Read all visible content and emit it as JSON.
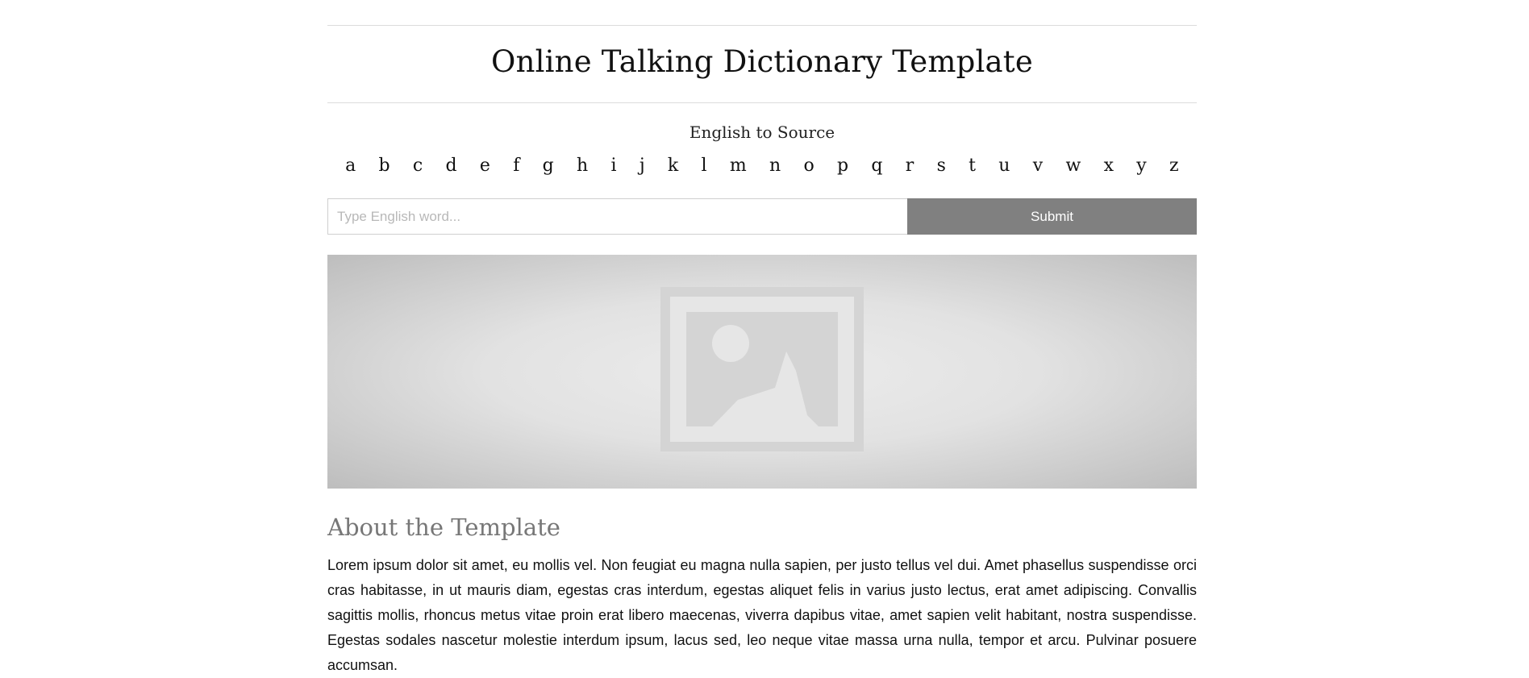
{
  "header": {
    "title": "Online Talking Dictionary Template"
  },
  "dictionary": {
    "direction_label": "English to Source",
    "letters": [
      "a",
      "b",
      "c",
      "d",
      "e",
      "f",
      "g",
      "h",
      "i",
      "j",
      "k",
      "l",
      "m",
      "n",
      "o",
      "p",
      "q",
      "r",
      "s",
      "t",
      "u",
      "v",
      "w",
      "x",
      "y",
      "z"
    ]
  },
  "search": {
    "placeholder": "Type English word...",
    "value": "",
    "submit_label": "Submit"
  },
  "hero": {
    "icon": "image-placeholder-icon"
  },
  "about": {
    "heading": "About the Template",
    "body": "Lorem ipsum dolor sit amet, eu mollis vel. Non feugiat eu magna nulla sapien, per justo tellus vel dui. Amet phasellus suspendisse orci cras habitasse, in ut mauris diam, egestas cras interdum, egestas aliquet felis in varius justo lectus, erat amet adipiscing. Convallis sagittis mollis, rhoncus metus vitae proin erat libero maecenas, viverra dapibus vitae, amet sapien velit habitant, nostra suspendisse. Egestas sodales nascetur molestie interdum ipsum, lacus sed, leo neque vitae massa urna nulla, tempor et arcu. Pulvinar posuere accumsan."
  },
  "colors": {
    "button_bg": "#808080",
    "heading_gray": "#777777",
    "rule": "#dcdcdc"
  }
}
